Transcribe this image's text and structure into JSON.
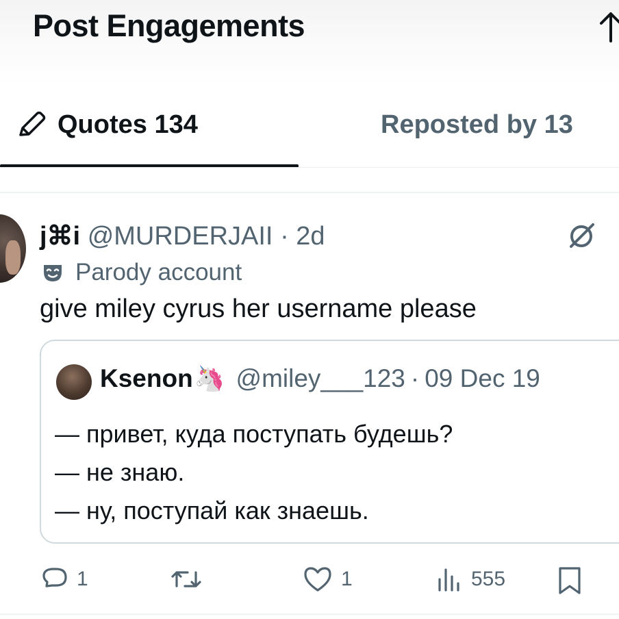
{
  "header": {
    "title": "Post Engagements",
    "back_icon": "arrow-up-icon"
  },
  "tabs": [
    {
      "label": "Quotes 134",
      "icon": "pencil-icon",
      "active": true
    },
    {
      "label": "Reposted by 13",
      "active": false
    }
  ],
  "post": {
    "author_name": "j⌘i",
    "handle": "@MURDERJAII",
    "dot": "·",
    "time": "2d",
    "badge_label": "Parody account",
    "badge_icon": "mask-icon",
    "text": "give miley cyrus her username please",
    "quote": {
      "author_name": "Ksenon",
      "author_emoji": "🦄",
      "handle": "@miley___123",
      "dot": "·",
      "date": "09 Dec 19",
      "lines": [
        "— привет, куда поступать будешь?",
        "— не знаю.",
        "— ну, поступай как знаешь."
      ]
    },
    "actions": {
      "replies": "1",
      "reposts": "",
      "likes": "1",
      "views": "555"
    }
  },
  "colors": {
    "text": "#0f1419",
    "secondary": "#536471",
    "border": "#cfd9de"
  }
}
